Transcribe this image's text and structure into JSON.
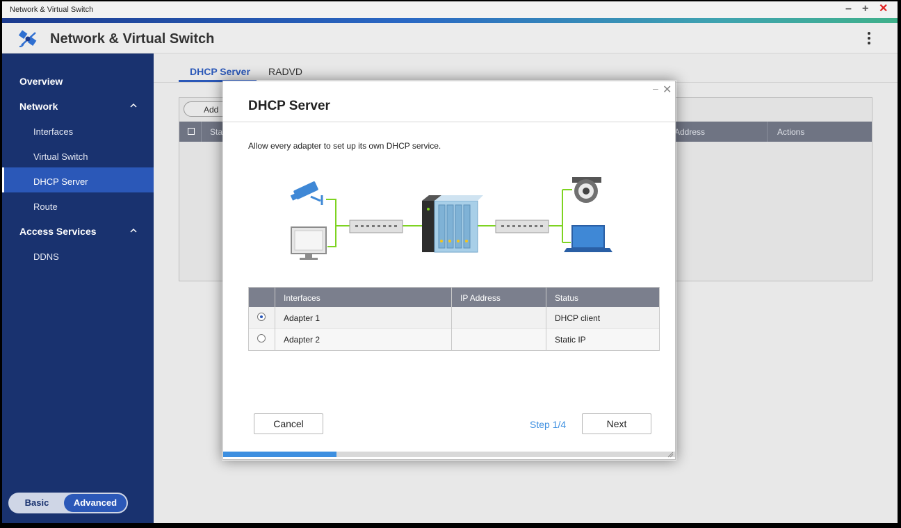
{
  "window": {
    "title": "Network & Virtual Switch",
    "controls": [
      "minimize-icon",
      "maximize-icon",
      "close-icon"
    ],
    "close_color": "#e02020"
  },
  "app": {
    "title": "Network & Virtual Switch",
    "icon": "network-satellite-icon",
    "menu_icon": "kebab-menu-icon"
  },
  "sidebar": {
    "items": [
      {
        "label": "Overview",
        "level": "heading"
      },
      {
        "label": "Network",
        "level": "heading",
        "expanded": true
      },
      {
        "label": "Interfaces",
        "level": "sub"
      },
      {
        "label": "Virtual Switch",
        "level": "sub"
      },
      {
        "label": "DHCP Server",
        "level": "sub",
        "active": true
      },
      {
        "label": "Route",
        "level": "sub"
      },
      {
        "label": "Access Services",
        "level": "heading",
        "expanded": true
      },
      {
        "label": "DDNS",
        "level": "sub"
      }
    ],
    "mode_toggle": {
      "basic": "Basic",
      "advanced": "Advanced",
      "selected": "Advanced"
    }
  },
  "main": {
    "tabs": [
      {
        "label": "DHCP Server",
        "active": true
      },
      {
        "label": "RADVD",
        "active": false
      }
    ],
    "add_button": "Add",
    "table_headers": {
      "status": "Sta",
      "ip": "Address",
      "actions": "Actions"
    }
  },
  "dialog": {
    "title": "DHCP Server",
    "description": "Allow every adapter to set up its own DHCP service.",
    "table": {
      "headers": [
        "Interfaces",
        "IP Address",
        "Status"
      ],
      "rows": [
        {
          "selected": true,
          "interface": "Adapter 1",
          "ip": "",
          "status": "DHCP client"
        },
        {
          "selected": false,
          "interface": "Adapter 2",
          "ip": "",
          "status": "Static IP"
        }
      ]
    },
    "cancel_label": "Cancel",
    "step_label": "Step 1/4",
    "next_label": "Next",
    "progress_fraction": 0.25,
    "accent_color": "#3d8fe0"
  }
}
